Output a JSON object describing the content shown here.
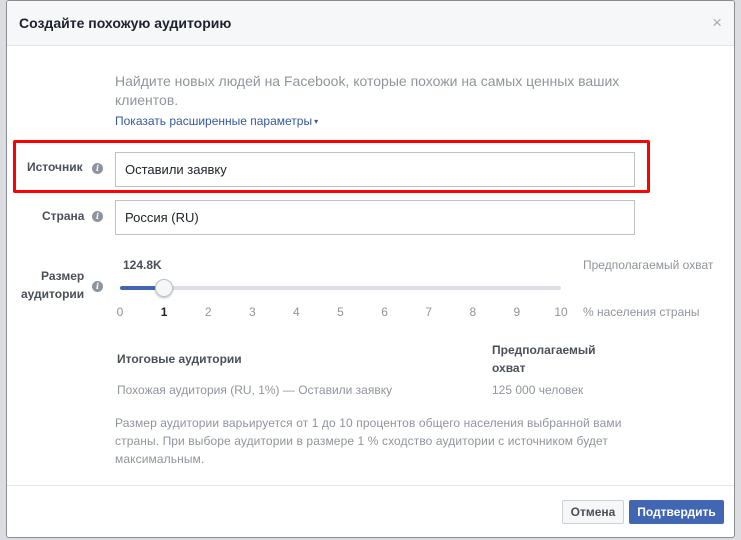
{
  "dialog": {
    "title": "Создайте похожую аудиторию",
    "close_symbol": "×",
    "intro": "Найдите новых людей на Facebook, которые похожи на самых ценных ваших клиентов.",
    "advanced_link": "Показать расширенные параметры",
    "advanced_caret": "▾"
  },
  "source": {
    "label": "Источник",
    "value": "Оставили заявку",
    "info_icon": "i"
  },
  "country": {
    "label": "Страна",
    "value": "Россия (RU)",
    "info_icon": "i"
  },
  "audience_size": {
    "label_line1": "Размер",
    "label_line2": "аудитории",
    "info_icon": "i",
    "slider_value": "124.8K",
    "estimated_reach_label": "Предполагаемый охват",
    "selected_percent": 1,
    "min": 0,
    "max": 10,
    "ticks": [
      "0",
      "1",
      "2",
      "3",
      "4",
      "5",
      "6",
      "7",
      "8",
      "9",
      "10"
    ],
    "percent_label": "% населения страны"
  },
  "summary": {
    "col1_header": "Итоговые аудитории",
    "col2_header_line1": "Предполагаемый",
    "col2_header_line2": "охват",
    "row_audience": "Похожая аудитория (RU, 1%) — Оставили заявку",
    "row_reach": "125 000 человек"
  },
  "note": "Размер аудитории варьируется от 1 до 10 процентов общего населения выбранной вами страны. При выборе аудитории в размере 1 % сходство аудитории с источником будет максимальным.",
  "buttons": {
    "cancel": "Отмена",
    "confirm": "Подтвердить"
  },
  "colors": {
    "accent": "#4267b2",
    "link": "#365899",
    "highlight": "#ff0000"
  }
}
